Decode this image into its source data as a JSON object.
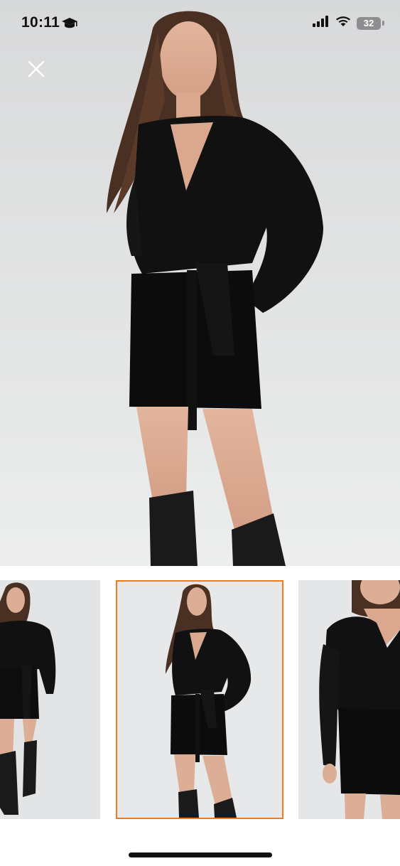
{
  "status_bar": {
    "time": "10:11",
    "battery_level": "32",
    "icons": [
      "education-cap-icon",
      "cellular-signal-icon",
      "wifi-icon",
      "battery-icon"
    ]
  },
  "viewer": {
    "close_icon": "close-icon",
    "selected_thumbnail_index": 1,
    "accent_color": "#f27a1a",
    "thumbnails": [
      {
        "name": "product-thumbnail-1"
      },
      {
        "name": "product-thumbnail-2"
      },
      {
        "name": "product-thumbnail-3"
      }
    ]
  }
}
